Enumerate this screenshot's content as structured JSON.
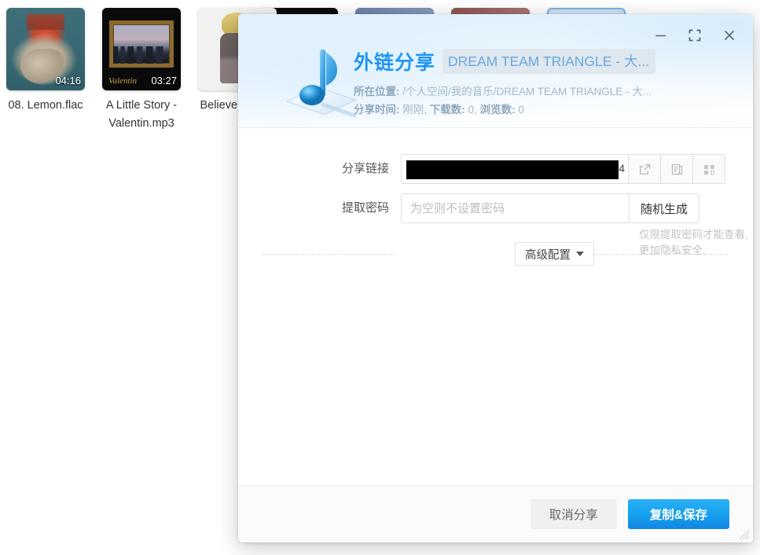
{
  "background": {
    "files": [
      {
        "name": "08. Lemon.flac",
        "duration": "04:16",
        "art": "art-lemon"
      },
      {
        "name": "A Little Story - Valentin.mp3",
        "duration": "03:27",
        "art": "art-story",
        "signature": "Valentin"
      },
      {
        "name": "Believe 阿保剛",
        "duration": "",
        "art": "art-believe"
      }
    ]
  },
  "dialog": {
    "window_controls": {
      "minimize": "minimize-icon",
      "fullscreen": "fullscreen-icon",
      "close": "close-icon"
    },
    "icon": "music-note-icon",
    "title": "外链分享",
    "file_chip": "DREAM TEAM TRIANGLE - 大...",
    "meta": {
      "location_label": "所在位置:",
      "location_value": "/个人空间/我的音乐/DREAM TEAM TRIANGLE - 大...",
      "share_time_label": "分享时间:",
      "share_time_value": "刚刚,",
      "downloads_label": "下载数:",
      "downloads_value": "0,",
      "views_label": "浏览数:",
      "views_value": "0"
    },
    "form": {
      "link": {
        "label": "分享链接",
        "value": "",
        "value_tail": "4",
        "redacted": true,
        "actions": [
          {
            "name": "open-external-icon"
          },
          {
            "name": "copy-icon"
          },
          {
            "name": "qrcode-icon"
          }
        ]
      },
      "password": {
        "label": "提取密码",
        "value": "",
        "placeholder": "为空则不设置密码",
        "generate_label": "随机生成",
        "hint": "仅限提取密码才能查看, 更加隐私安全."
      },
      "advanced_label": "高级配置"
    },
    "footer": {
      "cancel_label": "取消分享",
      "confirm_label": "复制&保存"
    }
  },
  "colors": {
    "accent": "#2196f3",
    "primary_button": "#17a3f0",
    "chip_bg": "#dfe7ef",
    "meta_text": "#9fb8cc"
  }
}
